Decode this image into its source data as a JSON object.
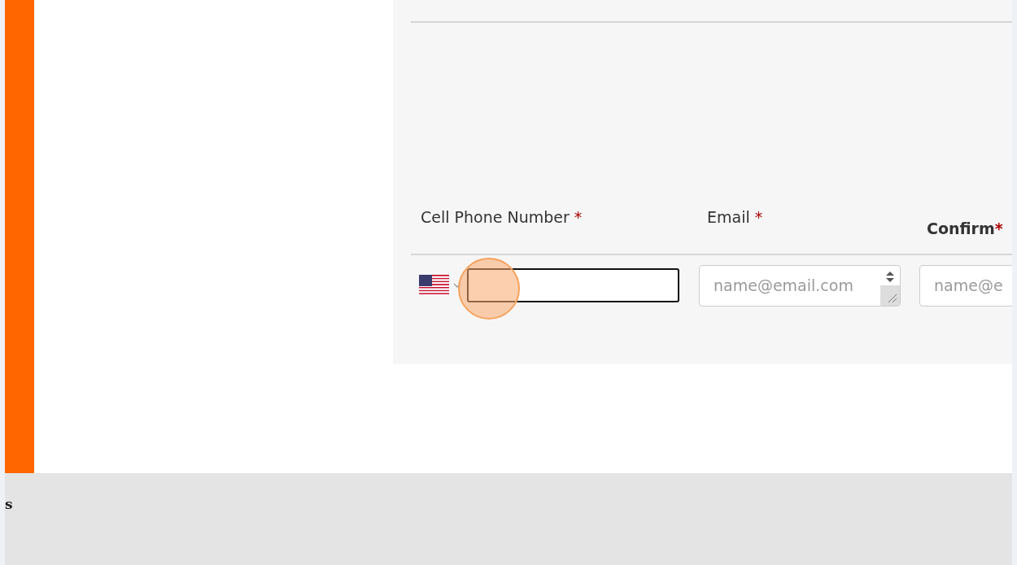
{
  "form": {
    "fields": [
      {
        "kind": "phone",
        "label": "Cell Phone Number",
        "required_mark": "*",
        "focused": true
      },
      {
        "kind": "email",
        "label": "Email",
        "required_mark": "*",
        "placeholder": "name@email.com"
      },
      {
        "kind": "confirm",
        "label": "Confirm",
        "required_mark": "*",
        "placeholder": "name@e"
      }
    ]
  },
  "footer": {
    "text": "s"
  }
}
